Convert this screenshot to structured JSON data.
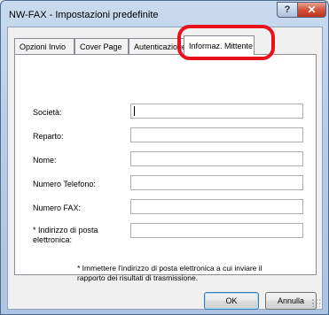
{
  "window": {
    "title": "NW-FAX - Impostazioni predefinite",
    "help_glyph": "?",
    "close_glyph": "✕"
  },
  "tabs": [
    {
      "label": "Opzioni Invio"
    },
    {
      "label": "Cover Page"
    },
    {
      "label": "Autenticazione"
    },
    {
      "label": "Informaz. Mittente",
      "active": true
    }
  ],
  "fields": [
    {
      "label": "Società:",
      "value": ""
    },
    {
      "label": "Reparto:",
      "value": ""
    },
    {
      "label": "Nome:",
      "value": ""
    },
    {
      "label": "Numero Telefono:",
      "value": ""
    },
    {
      "label": "Numero FAX:",
      "value": ""
    },
    {
      "label": "* Indirizzo di posta elettronica:",
      "value": ""
    }
  ],
  "note": "* Immettere l'indirizzo di posta elettronica a cui inviare il rapporto dei risultati di trasmissione.",
  "buttons": {
    "ok": "OK",
    "cancel": "Annulla"
  },
  "colors": {
    "highlight": "#e8101a",
    "close_button": "#c0331c"
  }
}
